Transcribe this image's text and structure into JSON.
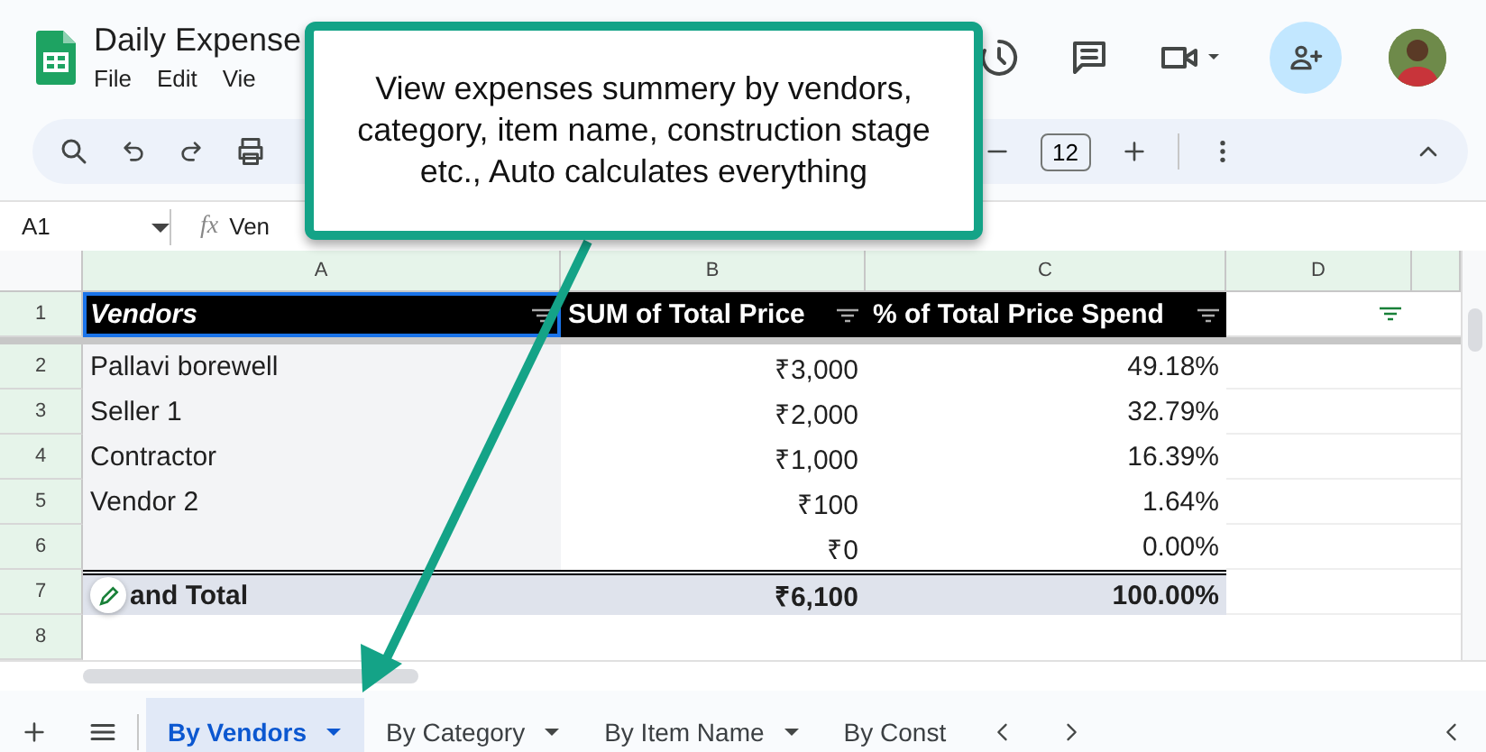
{
  "document": {
    "title": "Daily Expense",
    "menu": [
      "File",
      "Edit",
      "Vie"
    ]
  },
  "toolbar": {
    "font_size": "12"
  },
  "formula_bar": {
    "cell_ref": "A1",
    "fx": "fx",
    "content": "Ven"
  },
  "column_headers": [
    "A",
    "B",
    "C",
    "D"
  ],
  "row_numbers": [
    "1",
    "2",
    "3",
    "4",
    "5",
    "6",
    "7",
    "8"
  ],
  "pivot": {
    "header": [
      {
        "text": "Vendors",
        "selected": true
      },
      {
        "text": "SUM of Total Price",
        "selected": false
      },
      {
        "text": "% of Total Price Spend",
        "selected": false
      }
    ],
    "rows": [
      {
        "vendor": "Pallavi borewell",
        "sum": "₹3,000",
        "pct": "49.18%"
      },
      {
        "vendor": "Seller 1",
        "sum": "₹2,000",
        "pct": "32.79%"
      },
      {
        "vendor": "Contractor",
        "sum": "₹1,000",
        "pct": "16.39%"
      },
      {
        "vendor": "Vendor 2",
        "sum": "₹100",
        "pct": "1.64%"
      },
      {
        "vendor": "",
        "sum": "₹0",
        "pct": "0.00%"
      }
    ],
    "total": {
      "label": "and Total",
      "sum": "₹6,100",
      "pct": "100.00%"
    }
  },
  "sheet_tabs": [
    {
      "label": "By Vendors",
      "selected": true,
      "menu": true
    },
    {
      "label": "By Category",
      "selected": false,
      "menu": true
    },
    {
      "label": "By Item Name",
      "selected": false,
      "menu": true
    },
    {
      "label": "By Const",
      "selected": false,
      "menu": false
    }
  ],
  "callout": {
    "text": "View expenses summery by vendors, category, item name, construction stage etc., Auto calculates everything"
  }
}
